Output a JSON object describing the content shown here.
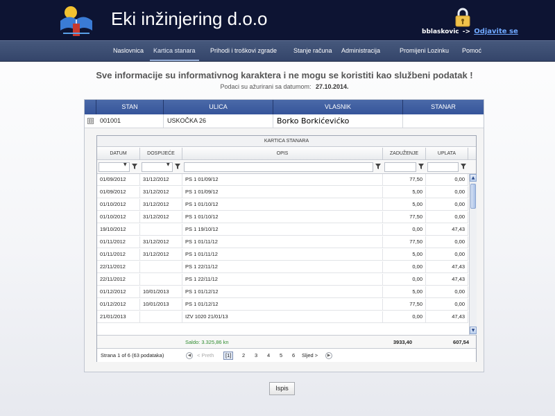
{
  "header": {
    "brand": "Eki inžinjering d.o.o",
    "username": "bblaskovic",
    "arrow": "->",
    "logout_label": "Odjavite se"
  },
  "nav": {
    "items": [
      {
        "label": "Naslovnica"
      },
      {
        "label": "Kartica stanara",
        "active": true
      },
      {
        "label": "Prihodi i troškovi zgrade"
      },
      {
        "label": "Stanje računa"
      },
      {
        "label": "Administracija"
      },
      {
        "label": "Promijeni Lozinku"
      },
      {
        "label": "Pomoć"
      }
    ]
  },
  "notice": {
    "text": "Sve informacije su informativnog karaktera i ne mogu se koristiti kao službeni podatak !",
    "updated_label": "Podaci su ažurirani sa datumom:",
    "updated_date": "27.10.2014."
  },
  "main_grid": {
    "columns": [
      "STAN",
      "ULICA",
      "VLASNIK",
      "STANAR"
    ],
    "row": {
      "expander": "⊟",
      "stan": "001001",
      "ulica": "USKOČKA 26",
      "vlasnik": "Borko Borkićevićko",
      "stanar": ""
    }
  },
  "detail": {
    "title": "KARTICA STANARA",
    "columns": [
      "DATUM",
      "DOSPIJEĆE",
      "OPIS",
      "ZADUŽENJE",
      "UPLATA"
    ],
    "rows": [
      [
        "01/09/2012",
        "31/12/2012",
        "PS 1 01/09/12",
        "77,50",
        "0,00"
      ],
      [
        "01/09/2012",
        "31/12/2012",
        "PS 1 01/09/12",
        "5,00",
        "0,00"
      ],
      [
        "01/10/2012",
        "31/12/2012",
        "PS 1 01/10/12",
        "5,00",
        "0,00"
      ],
      [
        "01/10/2012",
        "31/12/2012",
        "PS 1 01/10/12",
        "77,50",
        "0,00"
      ],
      [
        "19/10/2012",
        "",
        "PS 1 19/10/12",
        "0,00",
        "47,43"
      ],
      [
        "01/11/2012",
        "31/12/2012",
        "PS 1 01/11/12",
        "77,50",
        "0,00"
      ],
      [
        "01/11/2012",
        "31/12/2012",
        "PS 1 01/11/12",
        "5,00",
        "0,00"
      ],
      [
        "22/11/2012",
        "",
        "PS 1 22/11/12",
        "0,00",
        "47,43"
      ],
      [
        "22/11/2012",
        "",
        "PS 1 22/11/12",
        "0,00",
        "47,43"
      ],
      [
        "01/12/2012",
        "10/01/2013",
        "PS 1 01/12/12",
        "5,00",
        "0,00"
      ],
      [
        "01/12/2012",
        "10/01/2013",
        "PS 1 01/12/12",
        "77,50",
        "0,00"
      ],
      [
        "21/01/2013",
        "",
        "IZV 1020 21/01/13",
        "0,00",
        "47,43"
      ]
    ],
    "saldo": "Saldo: 3.325,86 kn",
    "total_zaduzenje": "3933,40",
    "total_uplata": "607,54",
    "pager": {
      "info": "Strana 1 of 6 (63 podataka)",
      "prev": "< Preth",
      "current": "[1]",
      "pages": [
        "2",
        "3",
        "4",
        "5",
        "6"
      ],
      "next": "Sljed >"
    }
  },
  "print_button": "Ispis",
  "colors": {
    "header_bg": "#0d1433",
    "nav_bg": "#3d4f75",
    "grid_header": "#4262a3",
    "saldo": "#2e8b2e",
    "link": "#6fa8ff"
  }
}
